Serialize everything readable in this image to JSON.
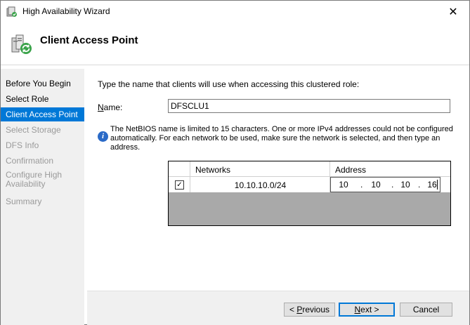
{
  "window": {
    "title": "High Availability Wizard",
    "close_glyph": "✕",
    "accent": "#0078d7"
  },
  "header": {
    "title": "Client Access Point",
    "icon": "cluster-wizard-icon"
  },
  "sidebar": {
    "items": [
      {
        "label": "Before You Begin",
        "state": "normal"
      },
      {
        "label": "Select Role",
        "state": "normal"
      },
      {
        "label": "Client Access Point",
        "state": "active"
      },
      {
        "label": "Select Storage",
        "state": "disabled"
      },
      {
        "label": "DFS Info",
        "state": "disabled"
      },
      {
        "label": "Confirmation",
        "state": "disabled"
      },
      {
        "label_line1": "Configure High",
        "label_line2": "Availability",
        "state": "disabled"
      },
      {
        "label": "Summary",
        "state": "disabled"
      }
    ]
  },
  "main": {
    "prompt": "Type the name that clients will use when accessing this clustered role:",
    "name_label_mnemonic": "N",
    "name_label_rest": "ame:",
    "name_value": "DFSCLU1",
    "info_icon_glyph": "i",
    "info_text": "The NetBIOS name is limited to 15 characters.  One or more IPv4 addresses could not be configured automatically.  For each network to be used, make sure the network is selected, and then type an address.",
    "grid": {
      "headers": {
        "networks": "Networks",
        "address": "Address"
      },
      "rows": [
        {
          "checked": true,
          "check_glyph": "✓",
          "network": "10.10.10.0/24",
          "octets": [
            "10",
            "10",
            "10",
            "16"
          ]
        }
      ]
    },
    "octet_separator": "."
  },
  "footer": {
    "previous_mnemonic": "P",
    "previous_rest": "revious",
    "previous_prefix": "< ",
    "next_mnemonic": "N",
    "next_rest": "ext >",
    "cancel_label": "Cancel"
  }
}
